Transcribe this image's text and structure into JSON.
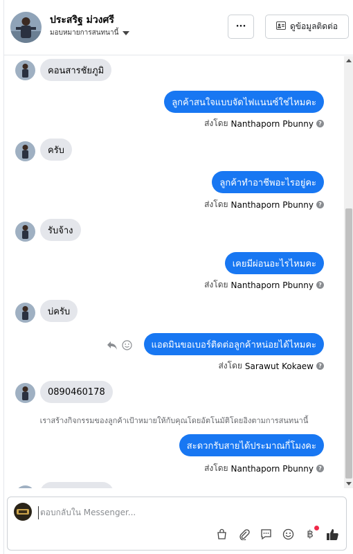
{
  "header": {
    "name": "ประสริฐ ม่วงศรี",
    "subtitle": "มอบหมายการสนทนานี้",
    "more_label": "···",
    "contact_label": "ดูข้อมูลติดต่อ"
  },
  "messages": [
    {
      "dir": "in",
      "text": "คอนสารชัยภูมิ"
    },
    {
      "dir": "out",
      "text": "ลูกค้าสนใจแบบจัดไฟแนนซ์ใช่ไหมคะ",
      "sent_prefix": "ส่งโดย",
      "sender": "Nanthaporn Pbunny"
    },
    {
      "dir": "in",
      "text": "ครับ"
    },
    {
      "dir": "out",
      "text": "ลูกค้าทำอาชีพอะไรอยู่คะ",
      "sent_prefix": "ส่งโดย",
      "sender": "Nanthaporn Pbunny"
    },
    {
      "dir": "in",
      "text": "รับจ้าง"
    },
    {
      "dir": "out",
      "text": "เคยมีผ่อนอะไรไหมคะ",
      "sent_prefix": "ส่งโดย",
      "sender": "Nanthaporn Pbunny"
    },
    {
      "dir": "in",
      "text": "บ่ครับ"
    },
    {
      "dir": "out",
      "text": "แอดมินขอเบอร์ติดต่อลูกค้าหน่อยได้ไหมคะ",
      "sent_prefix": "ส่งโดย",
      "sender": "Sarawut Kokaew"
    },
    {
      "dir": "in",
      "text": "0890460178"
    },
    {
      "dir": "out",
      "text": "สะดวกรับสายได้ประมาณกี่โมงคะ",
      "sent_prefix": "ส่งโดย",
      "sender": "Nanthaporn Pbunny"
    }
  ],
  "notice": "เราสร้างกิจกรรมของลูกค้าเป้าหมายให้กับคุณโดยอัตโนมัติโดยอิงตามการสนทนานี้",
  "composer": {
    "placeholder": "ตอบกลับใน Messenger..."
  },
  "colors": {
    "outgoing_bubble": "#1877f2",
    "incoming_bubble": "#e4e6eb",
    "notification_dot": "#f02849"
  },
  "icons": [
    "more-icon",
    "contact-card-icon",
    "reply-icon",
    "emoji-icon",
    "help-icon",
    "shop-icon",
    "attach-icon",
    "saved-reply-icon",
    "emoji-icon",
    "baht-icon",
    "thumbs-up-icon"
  ]
}
